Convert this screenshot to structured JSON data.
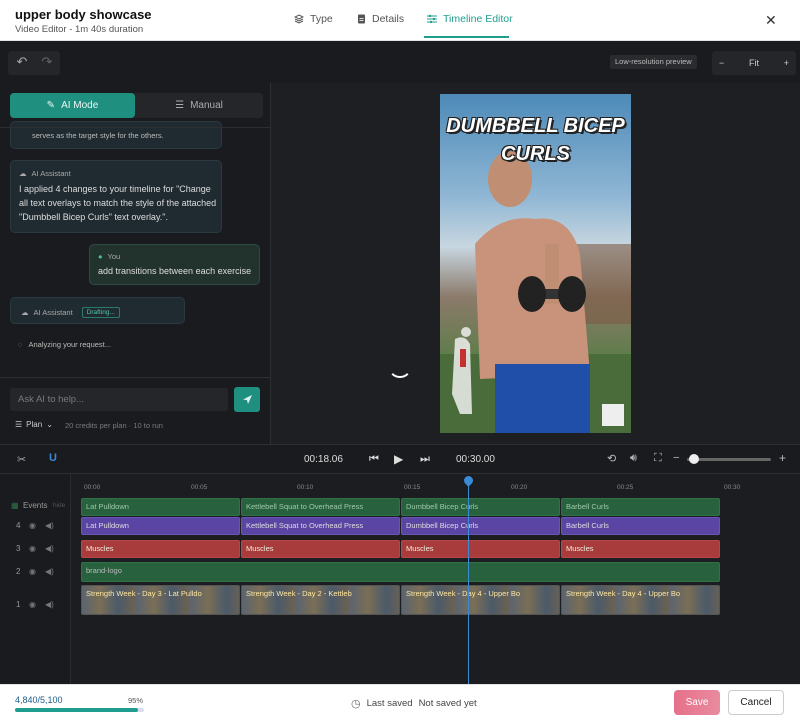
{
  "header": {
    "title": "upper body showcase",
    "subtitle": "Video Editor - 1m 40s duration",
    "tabs": [
      {
        "label": "Type",
        "icon": "layers-icon"
      },
      {
        "label": "Details",
        "icon": "document-icon"
      },
      {
        "label": "Timeline Editor",
        "icon": "sliders-icon",
        "active": true
      }
    ],
    "close_icon": "close-icon"
  },
  "toolbar": {
    "undo_icon": "undo-icon",
    "redo_icon": "redo-icon",
    "preview_badge": "Low-resolution preview",
    "zoom_minus": "−",
    "zoom_value": "Fit",
    "zoom_plus": "+"
  },
  "left_panel": {
    "mode_tabs": {
      "ai": "AI Mode",
      "manual": "Manual"
    },
    "messages": [
      {
        "role": "partial",
        "text": "serves as the target style for the others."
      },
      {
        "role": "assistant",
        "name": "AI Assistant",
        "text": "I applied 4 changes to your timeline for \"Change all text overlays to match the style of the attached \"Dumbbell Bicep Curls\" text overlay.\"."
      },
      {
        "role": "user",
        "name": "You",
        "text": "add transitions between each exercise"
      },
      {
        "role": "assistant",
        "name": "AI Assistant",
        "status": "Drafting..."
      }
    ],
    "analyzing": "Analyzing your request...",
    "input": {
      "placeholder": "Ask AI to help..."
    },
    "plan_label": "Plan",
    "credits_note": "20 credits per plan · 10 to run"
  },
  "preview": {
    "overlay_title_line1": "DUMBBELL BICEP",
    "overlay_title_line2": "CURLS"
  },
  "controls": {
    "current_time": "00:18.06",
    "total_time": "00:30.00",
    "volume_level": 0.02,
    "zoom_minus": "−",
    "zoom_plus": "+"
  },
  "timeline": {
    "ruler": [
      "00:00",
      "00:05",
      "00:10",
      "00:15",
      "00:20",
      "00:25",
      "00:30"
    ],
    "tracks": [
      {
        "label": "Events",
        "sub": "hide",
        "clips": [
          "Lat Pulldown",
          "Kettlebell Squat to Overhead Press",
          "Dumbbell Bicep Curls",
          "Barbell Curls"
        ]
      },
      {
        "label": "4",
        "clips": [
          "Lat Pulldown",
          "Kettlebell Squat to Overhead Press",
          "Dumbbell Bicep Curls",
          "Barbell Curls"
        ]
      },
      {
        "label": "3",
        "clips": [
          "Muscles",
          "Muscles",
          "Muscles",
          "Muscles"
        ]
      },
      {
        "label": "2",
        "clips": [
          "brand-logo"
        ]
      },
      {
        "label": "1",
        "clips": [
          "Strength Week - Day 3 - Lat Pulldo",
          "Strength Week - Day 2 - Kettleb",
          "Strength Week - Day 4 - Upper Bo",
          "Strength Week - Day 4 - Upper Bo"
        ]
      }
    ]
  },
  "footer": {
    "usage": "4,840/5,100",
    "usage_pct": "95%",
    "usage_fraction": 0.95,
    "saved_label": "Last saved",
    "saved_value": "Not saved yet",
    "save": "Save",
    "cancel": "Cancel"
  },
  "colors": {
    "accent": "#1f9e8f",
    "save": "#e6708a",
    "playhead": "#3a8ad6"
  }
}
